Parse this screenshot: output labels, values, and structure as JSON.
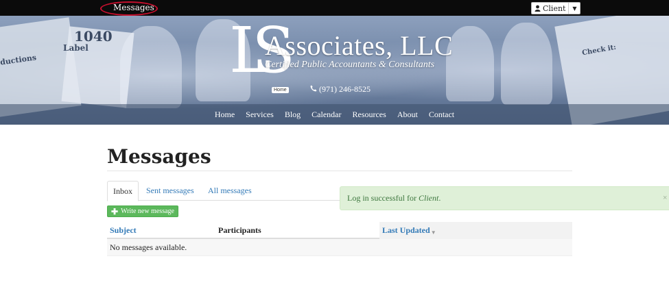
{
  "topbar": {
    "messages_link": "Messages",
    "client_button": "Client"
  },
  "hero": {
    "logo_letters": "LS",
    "company_name": "Associates, LLC",
    "tagline": "Certified Public Accountants & Consultants",
    "home_tooltip": "Home",
    "phone": "(971) 246-8525",
    "background_text": {
      "form_1040": "1040",
      "label": "Label",
      "deductions": "ductions",
      "check_it": "Check it:"
    }
  },
  "nav": {
    "items": [
      "Home",
      "Services",
      "Blog",
      "Calendar",
      "Resources",
      "About",
      "Contact"
    ]
  },
  "main": {
    "title": "Messages",
    "tabs": [
      {
        "label": "Inbox",
        "active": true
      },
      {
        "label": "Sent messages",
        "active": false
      },
      {
        "label": "All messages",
        "active": false
      }
    ],
    "write_button": "Write new message"
  },
  "alert": {
    "prefix": "Log in successful for ",
    "user": "Client",
    "suffix": ".",
    "close": "×"
  },
  "table": {
    "columns": [
      "Subject",
      "Participants",
      "Last Updated"
    ],
    "empty_message": "No messages available."
  },
  "colors": {
    "topbar": "#0b0b0b",
    "link": "#337ab7",
    "success_button": "#5cb85c",
    "alert_bg": "#dff0d8",
    "alert_text": "#3c763d",
    "highlight_ring": "#c8102e"
  },
  "icons": {
    "client_button": "user-icon",
    "client_dropdown": "caret-down-icon",
    "phone": "phone-icon",
    "write_button": "plus-icon",
    "sort": "sort-desc-icon"
  }
}
